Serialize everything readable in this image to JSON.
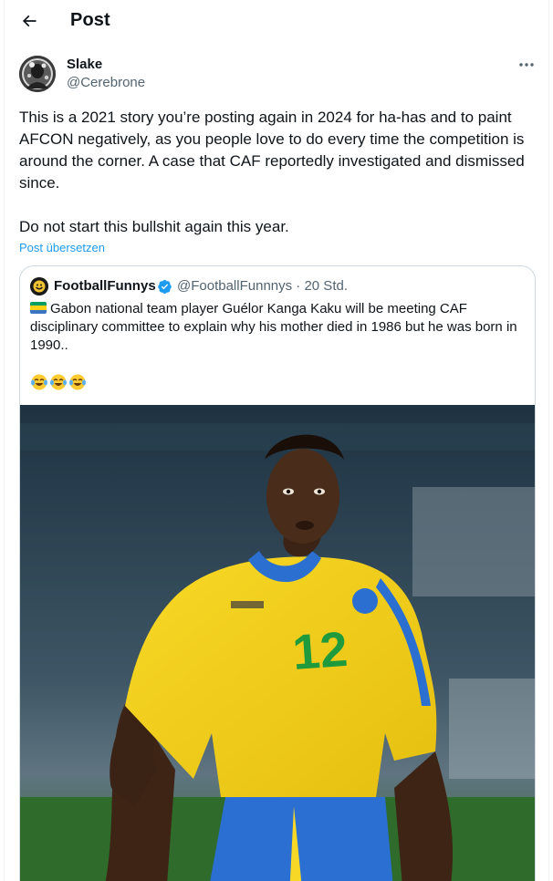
{
  "header": {
    "title": "Post"
  },
  "post": {
    "author_name": "Slake",
    "author_handle": "@Cerebrone",
    "paragraphs": [
      "This is a 2021 story you’re posting again in 2024 for ha-has and to paint AFCON negatively, as you people love to do every time the competition is around the corner. A case that CAF reportedly investigated and dismissed since.",
      "Do not start this bullshit again this year."
    ],
    "translate_label": "Post übersetzen"
  },
  "quote": {
    "author_name": "FootballFunnys",
    "author_handle": "@FootballFunnnys",
    "meta": "· 20 Std.",
    "text": "Gabon national team player Guélor Kanga Kaku will be meeting CAF disciplinary committee to explain why his mother died in 1986 but he was born in 1990..",
    "emojis": [
      "face-with-tears-of-joy",
      "face-with-tears-of-joy",
      "face-with-tears-of-joy"
    ],
    "media": {
      "jersey_number": "12"
    }
  },
  "icons": {
    "back": "arrow-left-icon",
    "more": "more-horizontal-icon",
    "verified": "verified-badge-icon",
    "flag": "gabon-flag-icon"
  },
  "colors": {
    "link": "#1d9bf0",
    "secondary_text": "#536471",
    "border": "#cfd9de",
    "verified": "#1d9bf0",
    "jersey_yellow": "#f6d21c",
    "jersey_green": "#1f9a3c",
    "shorts_blue": "#2a6fd1"
  }
}
